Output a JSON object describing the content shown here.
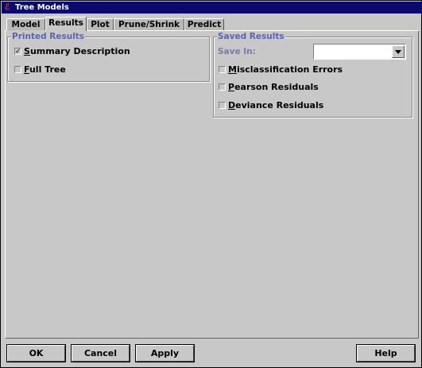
{
  "window": {
    "title": "Tree Models",
    "icon": "app-icon"
  },
  "tabs": [
    {
      "label": "Model",
      "active": false
    },
    {
      "label": "Results",
      "active": true
    },
    {
      "label": "Plot",
      "active": false
    },
    {
      "label": "Prune/Shrink",
      "active": false
    },
    {
      "label": "Predict",
      "active": false
    }
  ],
  "printed_results": {
    "title": "Printed Results",
    "summary_description": {
      "label": "Summary Description",
      "checked": true
    },
    "full_tree": {
      "label": "Full Tree",
      "checked": false
    }
  },
  "saved_results": {
    "title": "Saved Results",
    "save_in_label": "Save In:",
    "save_in_value": "",
    "misclassification_errors": {
      "label": "Misclassification Errors",
      "checked": false
    },
    "pearson_residuals": {
      "label": "Pearson Residuals",
      "checked": false
    },
    "deviance_residuals": {
      "label": "Deviance Residuals",
      "checked": false
    }
  },
  "buttons": {
    "ok": "OK",
    "cancel": "Cancel",
    "apply": "Apply",
    "help": "Help"
  },
  "colors": {
    "titlebar": "#0a0a6e",
    "group_label": "#5a64b4",
    "background": "#c8c8c8"
  }
}
